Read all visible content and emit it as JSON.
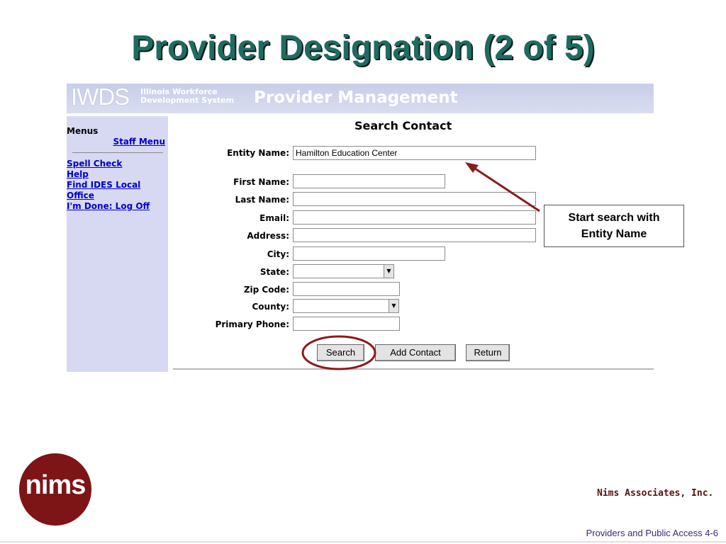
{
  "slide": {
    "title": "Provider Designation (2 of 5)",
    "footer": "Providers and Public Access  4-6",
    "company": "Nims Associates, Inc.",
    "logo_text": "nims"
  },
  "banner": {
    "logo": "IWDS",
    "subtitle_line1": "Illinois Workforce",
    "subtitle_line2": "Development System",
    "title": "Provider Management"
  },
  "sidebar": {
    "menus_label": "Menus",
    "staff_menu": "Staff Menu",
    "links": [
      "Spell Check",
      "Help",
      "Find IDES Local",
      "Office",
      "I'm Done: Log Off"
    ]
  },
  "form": {
    "heading": "Search Contact",
    "fields": {
      "entity_name": {
        "label": "Entity Name:",
        "value": "Hamilton Education Center"
      },
      "first_name": {
        "label": "First Name:",
        "value": ""
      },
      "last_name": {
        "label": "Last Name:",
        "value": ""
      },
      "email": {
        "label": "Email:",
        "value": ""
      },
      "address": {
        "label": "Address:",
        "value": ""
      },
      "city": {
        "label": "City:",
        "value": ""
      },
      "state": {
        "label": "State:",
        "value": ""
      },
      "zip": {
        "label": "Zip Code:",
        "value": ""
      },
      "county": {
        "label": "County:",
        "value": ""
      },
      "phone": {
        "label": "Primary Phone:",
        "value": ""
      }
    },
    "buttons": {
      "search": "Search",
      "add_contact": "Add Contact",
      "return": "Return"
    }
  },
  "annotation": {
    "callout_line1": "Start search with",
    "callout_line2": "Entity Name",
    "color": "#8b1a1a"
  }
}
